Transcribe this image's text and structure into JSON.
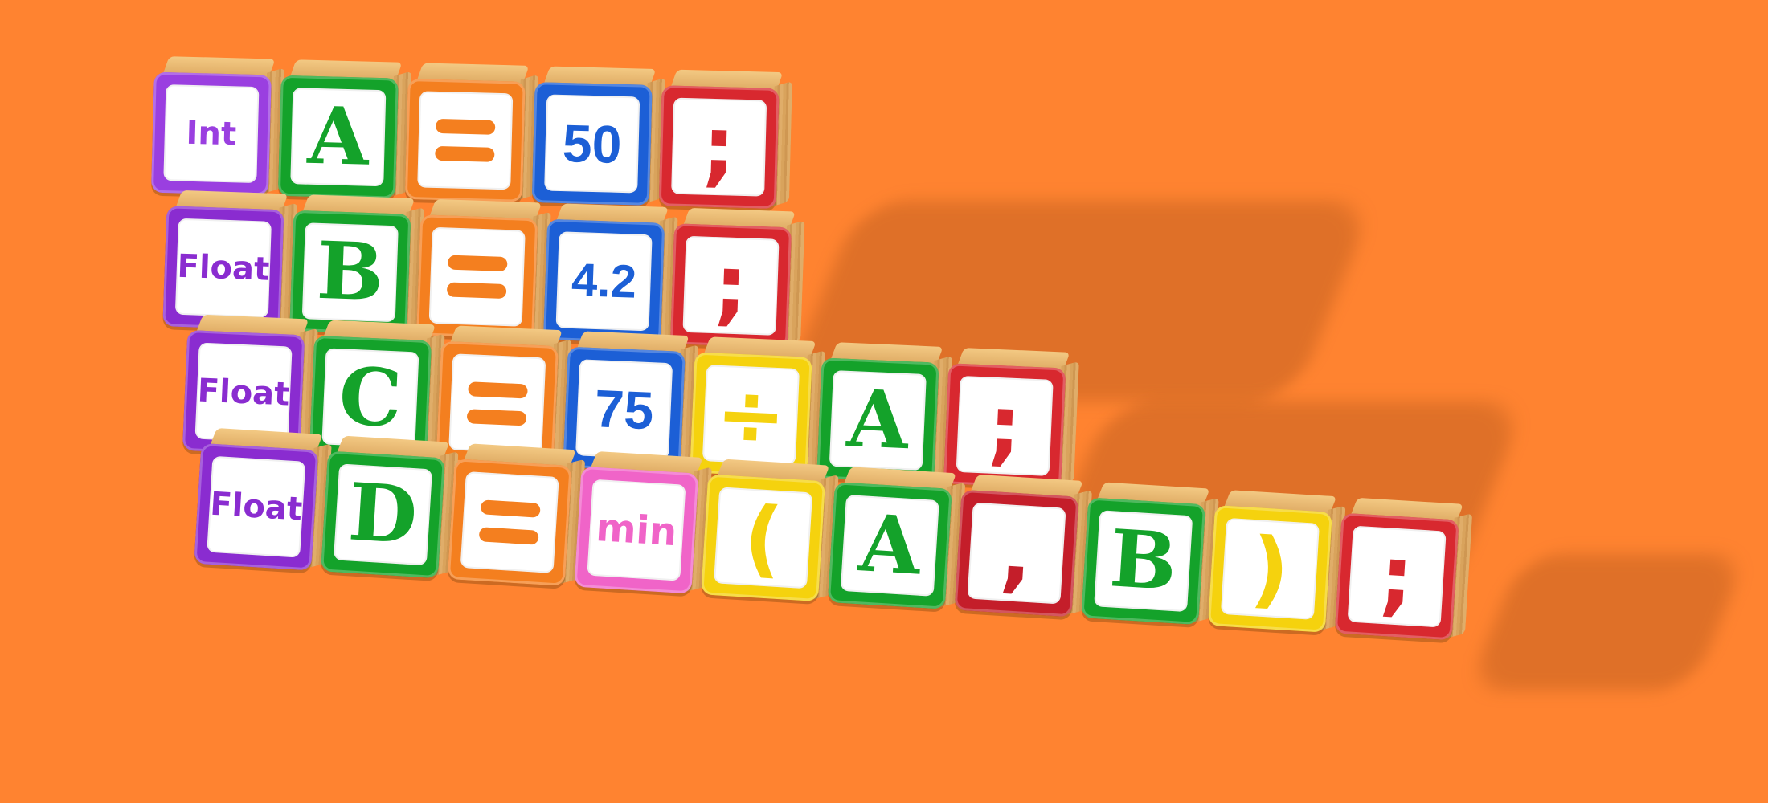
{
  "colors": {
    "background": "#FF8330",
    "purple": "#9A3FE0",
    "green": "#14A22A",
    "orange": "#F47F1F",
    "blue": "#1C5FD6",
    "red": "#D8282F",
    "yellow": "#F5D20E",
    "pink": "#F064C8"
  },
  "rows": [
    {
      "blocks": [
        {
          "text": "Int",
          "color": "#9A3FE0",
          "kind": "word"
        },
        {
          "text": "A",
          "color": "#14A22A",
          "kind": "letter"
        },
        {
          "text": "=",
          "color": "#F47F1F",
          "kind": "eq"
        },
        {
          "text": "50",
          "color": "#1C5FD6",
          "kind": "num"
        },
        {
          "text": ";",
          "color": "#D8282F",
          "kind": "sym"
        }
      ]
    },
    {
      "blocks": [
        {
          "text": "Float",
          "color": "#8A2CD0",
          "kind": "word"
        },
        {
          "text": "B",
          "color": "#14A22A",
          "kind": "letter"
        },
        {
          "text": "=",
          "color": "#F47F1F",
          "kind": "eq"
        },
        {
          "text": "4.2",
          "color": "#1C5FD6",
          "kind": "num small"
        },
        {
          "text": ";",
          "color": "#D8282F",
          "kind": "sym"
        }
      ]
    },
    {
      "blocks": [
        {
          "text": "Float",
          "color": "#8A2CD0",
          "kind": "word"
        },
        {
          "text": "C",
          "color": "#14A22A",
          "kind": "letter"
        },
        {
          "text": "=",
          "color": "#F47F1F",
          "kind": "eq"
        },
        {
          "text": "75",
          "color": "#1C5FD6",
          "kind": "num"
        },
        {
          "text": "÷",
          "color": "#F5D20E",
          "kind": "sym"
        },
        {
          "text": "A",
          "color": "#14A22A",
          "kind": "letter"
        },
        {
          "text": ";",
          "color": "#D8282F",
          "kind": "sym"
        }
      ]
    },
    {
      "blocks": [
        {
          "text": "Float",
          "color": "#8A2CD0",
          "kind": "word"
        },
        {
          "text": "D",
          "color": "#14A22A",
          "kind": "letter"
        },
        {
          "text": "=",
          "color": "#F47F1F",
          "kind": "eq"
        },
        {
          "text": "min",
          "color": "#F064C8",
          "kind": "min"
        },
        {
          "text": "(",
          "color": "#F5D20E",
          "kind": "sym"
        },
        {
          "text": "A",
          "color": "#14A22A",
          "kind": "letter"
        },
        {
          "text": ",",
          "color": "#C41E2A",
          "kind": "sym"
        },
        {
          "text": "B",
          "color": "#14A22A",
          "kind": "letter"
        },
        {
          "text": ")",
          "color": "#F5D20E",
          "kind": "sym"
        },
        {
          "text": ";",
          "color": "#D8282F",
          "kind": "sym"
        }
      ]
    }
  ]
}
